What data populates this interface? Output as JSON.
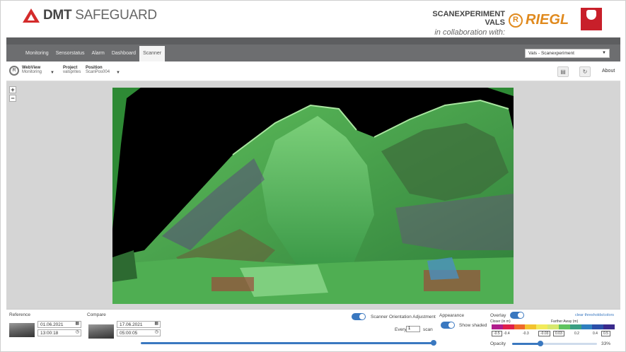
{
  "header": {
    "brand_main": "DMT",
    "brand_accent": "SAFEGUARD",
    "scan_title": "SCANEXPERIMENT VALS",
    "collab_text": "in collaboration with:",
    "riegl_text": "RIEGL",
    "tirol_text": "LAND TIROL"
  },
  "nav": {
    "tabs": [
      {
        "label": "Monitoring"
      },
      {
        "label": "Sensorstatus"
      },
      {
        "label": "Alarm"
      },
      {
        "label": "Dashboard"
      },
      {
        "label": "Scanner",
        "active": true
      }
    ],
    "project_select": "Vals - Scanexperiment"
  },
  "toolbar": {
    "webview_label": "WebView",
    "webview_value": "Monitoring",
    "project_label": "Project",
    "project_value": "valsprites",
    "position_label": "Position",
    "position_value": "ScanPos004",
    "about_label": "About"
  },
  "viewer": {
    "zoom_in": "+",
    "zoom_out": "−"
  },
  "bottom": {
    "reference_label": "Reference",
    "reference_date": "01.06.2021",
    "reference_time": "13:00:18",
    "compare_label": "Compare",
    "compare_date": "17.06.2021",
    "compare_time": "05:00:05",
    "orientation_label": "Scanner Orientation Adjustment",
    "every_label": "Every",
    "every_value": "1",
    "every_unit": "scan",
    "appearance_label": "Appearance",
    "show_shaded_label": "Show shaded",
    "overlay_label": "Overlay",
    "closer_label": "Closer (in m)",
    "farther_label": "Farther Away (m)",
    "clear_label": "clear thresholds/colors",
    "legend_values": [
      "-0.5",
      "-0.4",
      "-0.3",
      "-0.03",
      "0.03",
      "0.2",
      "0.4",
      "0.5"
    ],
    "opacity_label": "Opacity",
    "opacity_value": "33%",
    "opacity": 0.33
  },
  "colors": {
    "accent_blue": "#3a78c0",
    "nav_gray": "#6d6e70",
    "riegl_orange": "#e08a1e",
    "tirol_red": "#c81f2a"
  }
}
